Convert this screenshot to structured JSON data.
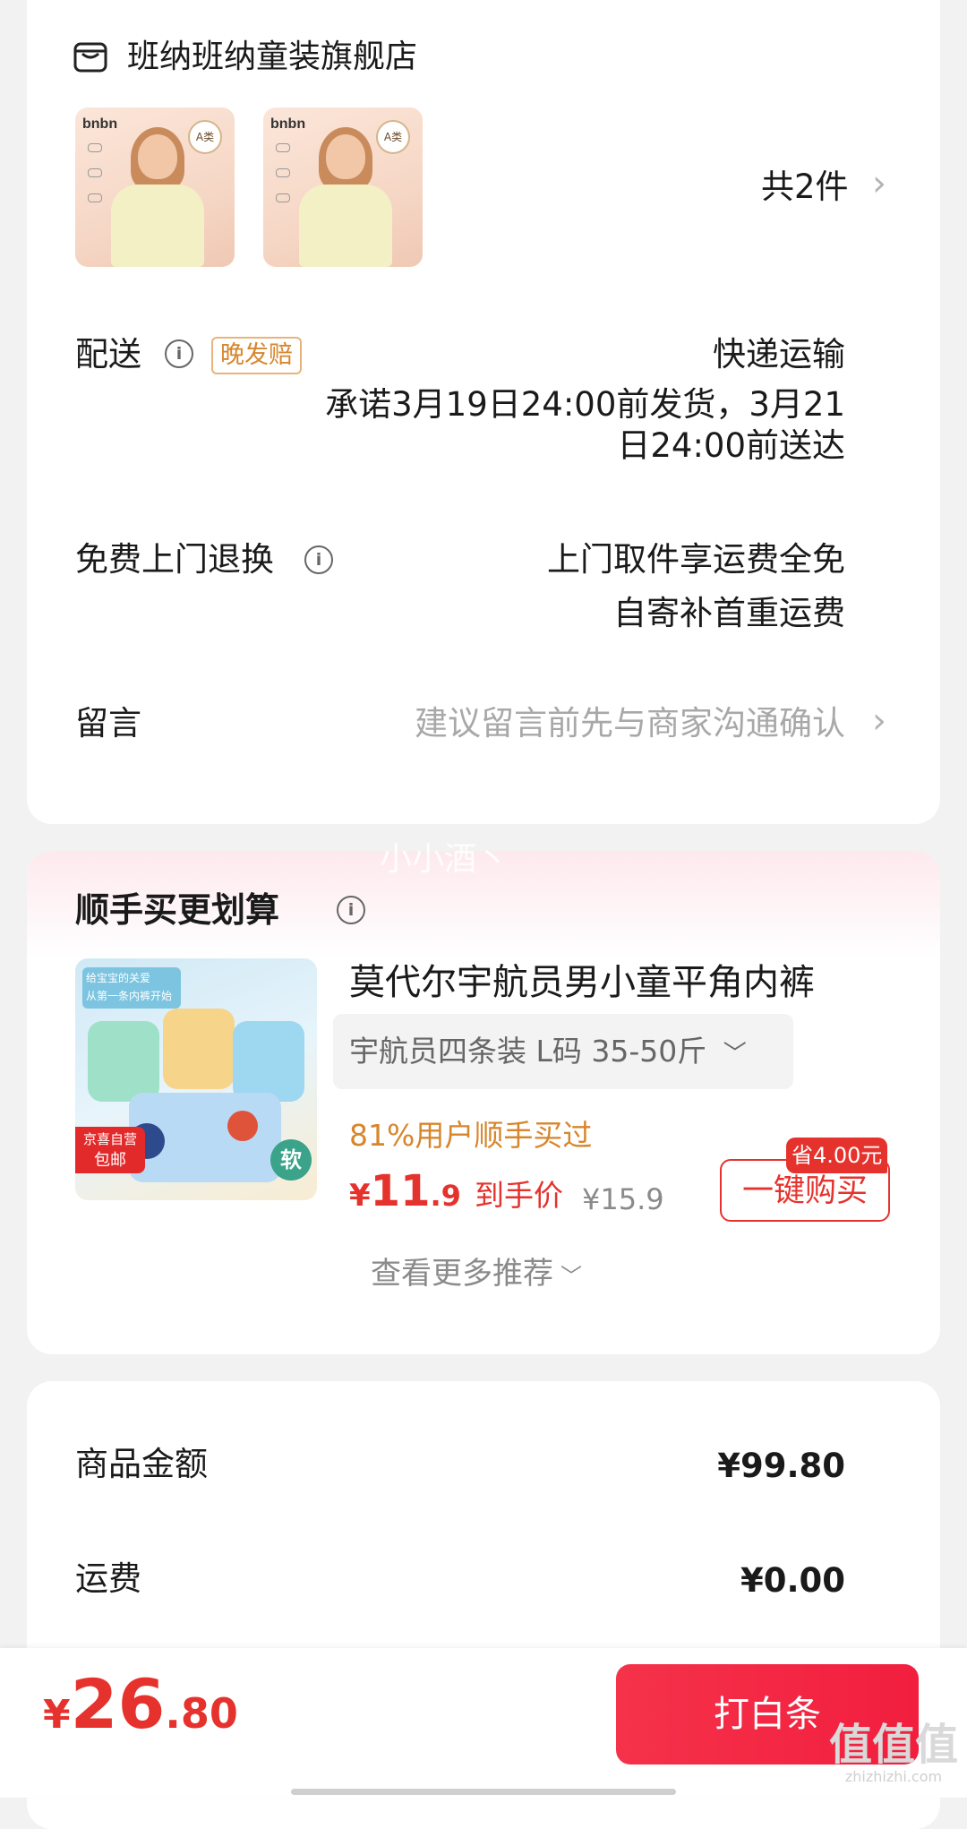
{
  "shop": {
    "name": "班纳班纳童装旗舰店"
  },
  "products": {
    "thumb_brand": "bnbn",
    "thumb_badge": "A类",
    "count_text": "共2件"
  },
  "delivery": {
    "label": "配送",
    "tag": "晚发赔",
    "method": "快递运输",
    "promise_line1": "承诺3月19日24:00前发货，3月21",
    "promise_line2": "日24:00前送达"
  },
  "returns": {
    "label": "免费上门退换",
    "line1": "上门取件享运费全免",
    "line2": "自寄补首重运费"
  },
  "message": {
    "label": "留言",
    "placeholder": "建议留言前先与商家沟通确认"
  },
  "watermark_text": "小小酒丶",
  "recommend": {
    "title": "顺手买更划算",
    "product_title": "莫代尔宇航员男小童平角内裤",
    "spec": "宇航员四条装   L码 35-50斤",
    "social_proof": "81%用户顺手买过",
    "price_symbol": "¥",
    "price_int": "11",
    "price_dec": ".9",
    "price_label": "到手价",
    "original_price": "¥15.9",
    "save_tag": "省4.00元",
    "buy_button": "一键购买",
    "more": "查看更多推荐",
    "img_banner": "给宝宝的关爱",
    "img_banner_sub": "从第一条内裤开始",
    "img_jd": "京喜自营",
    "img_jd_sub": "包邮",
    "img_soft": "软"
  },
  "summary": {
    "goods_label": "商品金额",
    "goods_value": "¥99.80",
    "shipping_label": "运费",
    "shipping_value": "¥0.00"
  },
  "bottom": {
    "total_symbol": "¥",
    "total_int": "26",
    "total_dec": ".80",
    "pay_button": "打白条"
  },
  "site_logo": {
    "mark": "值值值",
    "url_text": "zhizhizhi.com"
  },
  "colors": {
    "accent": "#e6322d",
    "orange": "#d7862c",
    "gray_text": "#a8a8a8"
  }
}
